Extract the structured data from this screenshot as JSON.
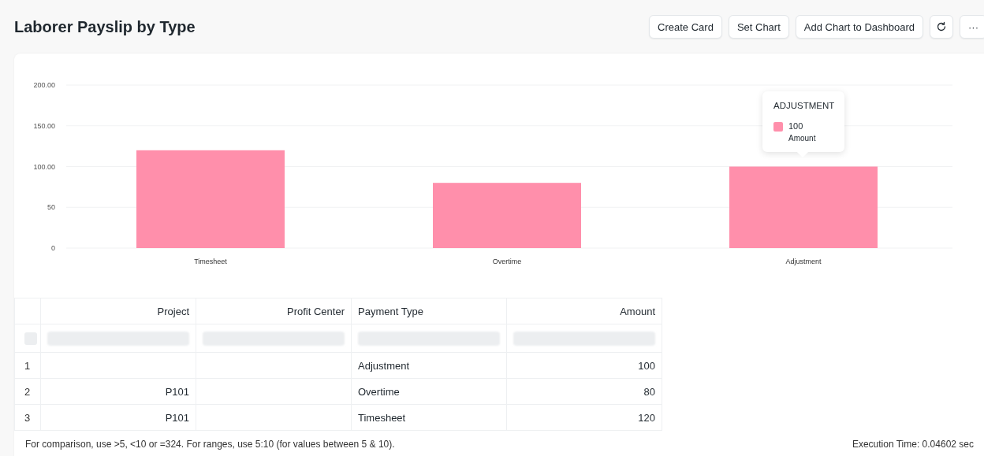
{
  "page": {
    "title": "Laborer Payslip by Type"
  },
  "toolbar": {
    "buttons": [
      {
        "kind": "text",
        "label": "Create Card"
      },
      {
        "kind": "text",
        "label": "Set Chart"
      },
      {
        "kind": "text",
        "label": "Add Chart to Dashboard"
      },
      {
        "kind": "refresh"
      },
      {
        "kind": "text",
        "label": "···"
      }
    ]
  },
  "chart": {
    "chart_data": {
      "type": "bar",
      "categories": [
        "Timesheet",
        "Overtime",
        "Adjustment"
      ],
      "series": [
        {
          "name": "Amount",
          "color": "#ff8fab",
          "values": [
            120,
            80,
            100
          ]
        }
      ],
      "grid": true,
      "ylim": [
        0,
        200
      ],
      "yticks": [
        0,
        50,
        {
          "value": 100,
          "label": "100.00"
        },
        {
          "value": 150,
          "label": "150.00"
        },
        {
          "value": 200,
          "label": "200.00"
        }
      ]
    },
    "tooltip": {
      "title": "ADJUSTMENT",
      "value": "100"
    }
  },
  "table": {
    "columns": [
      {
        "label": "Project"
      },
      {
        "label": "Profit Center"
      },
      {
        "label": "Payment Type"
      },
      {
        "label": "Amount"
      }
    ],
    "rows": [
      {
        "index": "1",
        "cells": [
          "",
          "",
          "Adjustment",
          "100"
        ]
      },
      {
        "index": "2",
        "cells": [
          "P101",
          "",
          "Overtime",
          "80"
        ]
      },
      {
        "index": "3",
        "cells": [
          "P101",
          "",
          "Timesheet",
          "120"
        ]
      }
    ]
  },
  "footer": {
    "hint": "For comparison, use >5, <10 or =324. For ranges, use 5:10 (for values between 5 & 10).",
    "execution_time": "Execution Time: 0.04602 sec"
  }
}
